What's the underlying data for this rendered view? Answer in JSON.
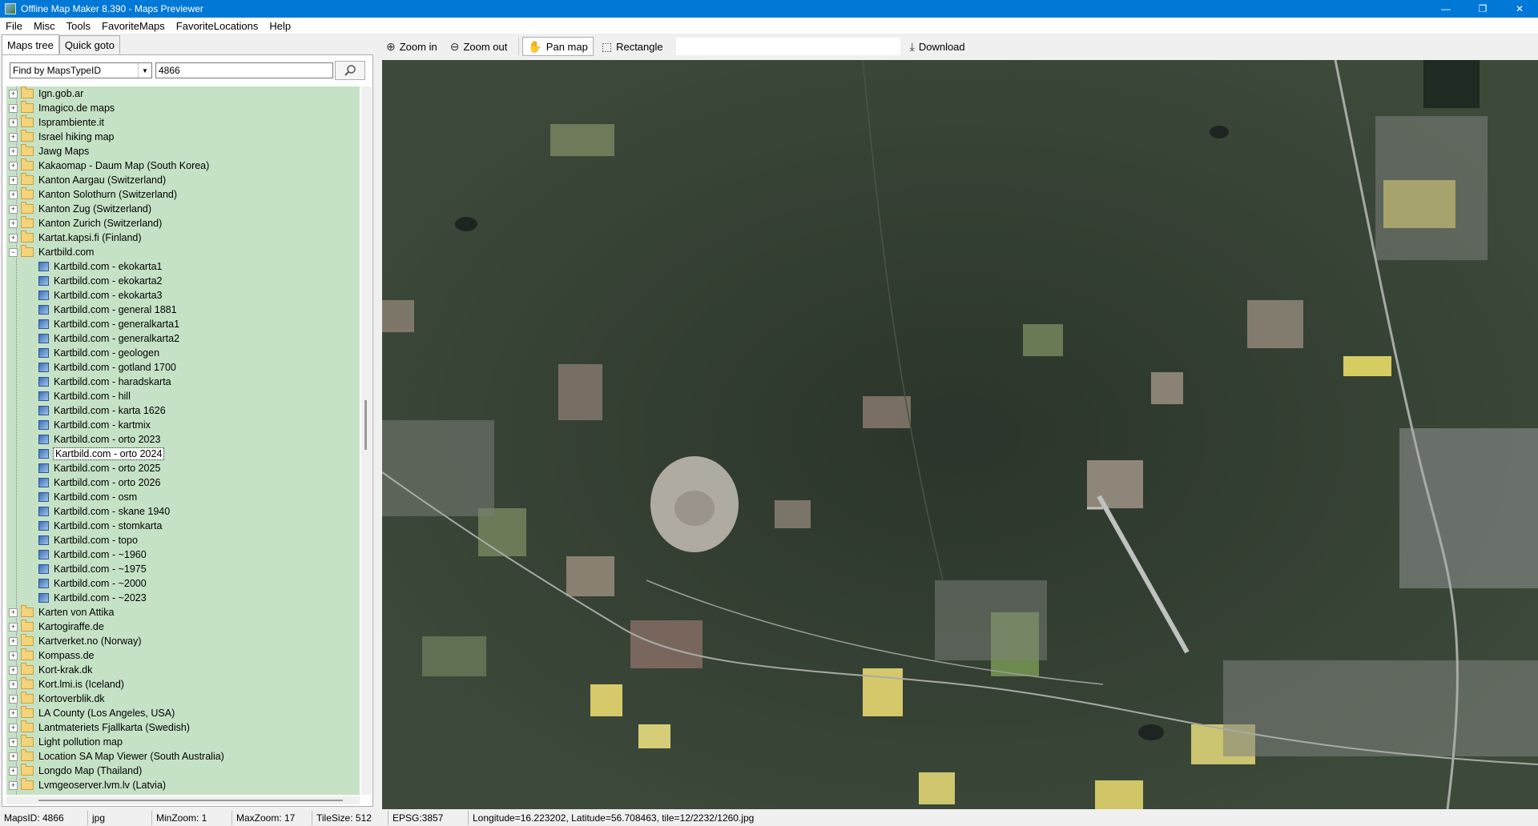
{
  "window": {
    "title": "Offline Map Maker 8.390 - Maps Previewer",
    "minimize": "—",
    "maximize": "❐",
    "close": "✕"
  },
  "menu": [
    "File",
    "Misc",
    "Tools",
    "FavoriteMaps",
    "FavoriteLocations",
    "Help"
  ],
  "left": {
    "tabs": [
      "Maps tree",
      "Quick goto"
    ],
    "finder_select": "Find by MapsTypeID",
    "search_value": "4866",
    "tree_before": [
      "Ign.gob.ar",
      "Imagico.de maps",
      "Isprambiente.it",
      "Israel hiking map",
      "Jawg Maps",
      "Kakaomap - Daum Map (South Korea)",
      "Kanton Aargau (Switzerland)",
      "Kanton Solothurn (Switzerland)",
      "Kanton Zug (Switzerland)",
      "Kanton Zurich (Switzerland)",
      "Kartat.kapsi.fi (Finland)"
    ],
    "expanded_folder": "Kartbild.com",
    "children": [
      "Kartbild.com - ekokarta1",
      "Kartbild.com - ekokarta2",
      "Kartbild.com - ekokarta3",
      "Kartbild.com - general 1881",
      "Kartbild.com - generalkarta1",
      "Kartbild.com - generalkarta2",
      "Kartbild.com - geologen",
      "Kartbild.com - gotland 1700",
      "Kartbild.com - haradskarta",
      "Kartbild.com - hill",
      "Kartbild.com - karta 1626",
      "Kartbild.com - kartmix",
      "Kartbild.com - orto 2023",
      "Kartbild.com - orto 2024",
      "Kartbild.com - orto 2025",
      "Kartbild.com - orto 2026",
      "Kartbild.com - osm",
      "Kartbild.com - skane 1940",
      "Kartbild.com - stomkarta",
      "Kartbild.com - topo",
      "Kartbild.com - ~1960",
      "Kartbild.com - ~1975",
      "Kartbild.com - ~2000",
      "Kartbild.com - ~2023"
    ],
    "selected_child": "Kartbild.com - orto 2024",
    "tree_after": [
      "Karten von Attika",
      "Kartogiraffe.de",
      "Kartverket.no (Norway)",
      "Kompass.de",
      "Kort-krak.dk",
      "Kort.lmi.is (Iceland)",
      "Kortoverblik.dk",
      "LA County (Los Angeles, USA)",
      "Lantmateriets Fjallkarta (Swedish)",
      "Light pollution map",
      "Location SA Map Viewer (South Australia)",
      "Longdo Map (Thailand)",
      "Lvmgeoserver.lvm.lv (Latvia)"
    ]
  },
  "toolbar": {
    "zoom_in": "Zoom in",
    "zoom_out": "Zoom out",
    "pan_map": "Pan map",
    "rectangle": "Rectangle",
    "download": "Download"
  },
  "status": {
    "maps_id": "MapsID: 4866",
    "format": "jpg",
    "min_zoom": "MinZoom: 1",
    "max_zoom": "MaxZoom: 17",
    "tile_size": "TileSize: 512",
    "epsg": "EPSG:3857",
    "coords": "Longitude=16.223202, Latitude=56.708463, tile=12/2232/1260.jpg"
  },
  "colors": {
    "titlebar": "#0078d7",
    "tree_bg": "#c6e2c6",
    "forest": "#2e3a2e"
  }
}
